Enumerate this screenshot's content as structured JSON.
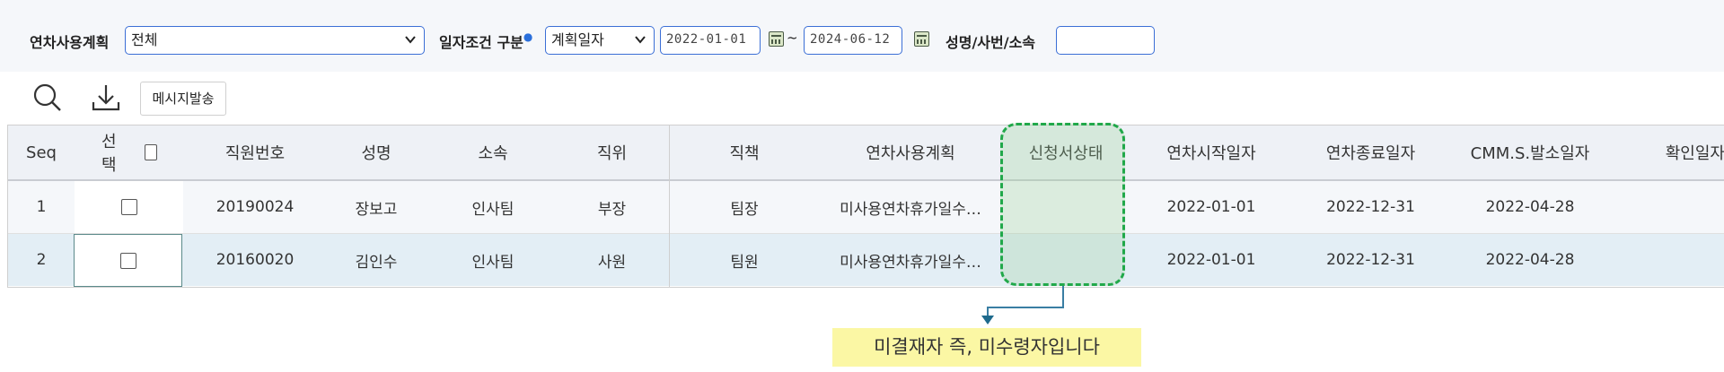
{
  "filters": {
    "plan_label": "연차사용계획",
    "plan_value": "전체",
    "date_cond_label": "일자조건 구분",
    "date_cond_value": "계획일자",
    "date_from": "2022-01-01",
    "tilde": "~",
    "date_to": "2024-06-12",
    "name_label": "성명/사번/소속",
    "name_value": ""
  },
  "toolbar": {
    "search_icon": "search-icon",
    "download_icon": "download-icon",
    "message_button": "메시지발송"
  },
  "table": {
    "columns": [
      "Seq",
      "선택",
      "직원번호",
      "성명",
      "소속",
      "직위",
      "직책",
      "연차사용계획",
      "신청서상태",
      "연차시작일자",
      "연차종료일자",
      "CMM.S.발소일자",
      "확인일자"
    ],
    "rows": [
      {
        "seq": "1",
        "emp_no": "20190024",
        "name": "장보고",
        "dept": "인사팀",
        "position": "부장",
        "duty": "팀장",
        "plan": "미사용연차휴가일수…",
        "status": "",
        "start": "2022-01-01",
        "end": "2022-12-31",
        "sent": "2022-04-28",
        "confirm": ""
      },
      {
        "seq": "2",
        "emp_no": "20160020",
        "name": "김인수",
        "dept": "인사팀",
        "position": "사원",
        "duty": "팀원",
        "plan": "미사용연차휴가일수…",
        "status": "",
        "start": "2022-01-01",
        "end": "2022-12-31",
        "sent": "2022-04-28",
        "confirm": ""
      }
    ]
  },
  "annotation": {
    "note": "미결재자 즉, 미수령자입니다",
    "highlight_color": "#21a84a",
    "note_bg": "#fbf7a4"
  },
  "colors": {
    "accent_border": "#3b6fd6",
    "selected_row": "#e3eef5"
  }
}
